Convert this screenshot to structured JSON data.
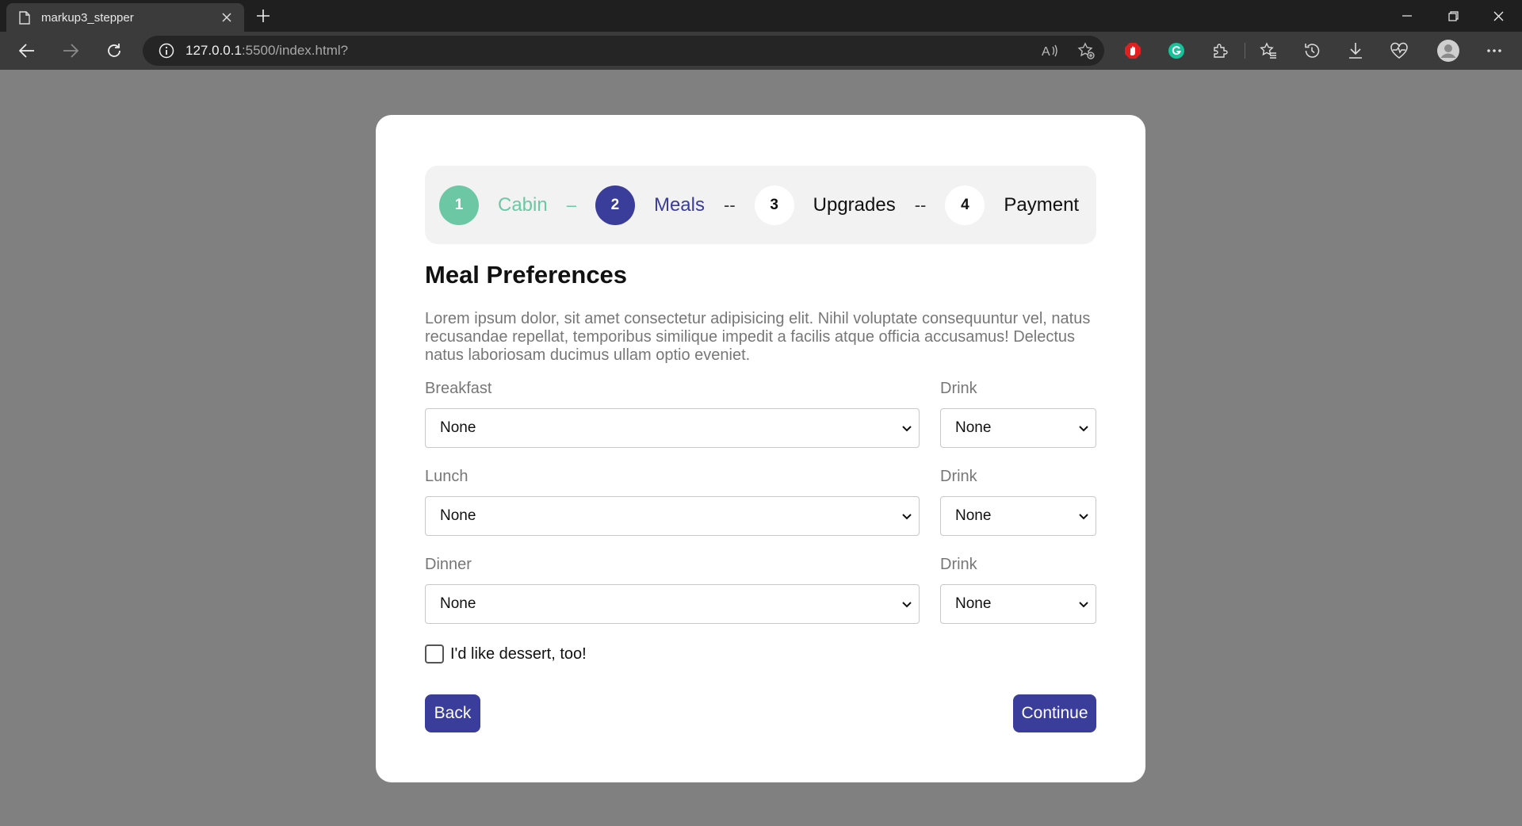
{
  "browser": {
    "tab_title": "markup3_stepper",
    "url_host": "127.0.0.1",
    "url_rest": ":5500/index.html?"
  },
  "stepper": {
    "steps": [
      {
        "number": "1",
        "label": "Cabin",
        "state": "done"
      },
      {
        "number": "2",
        "label": "Meals",
        "state": "active"
      },
      {
        "number": "3",
        "label": "Upgrades",
        "state": "todo"
      },
      {
        "number": "4",
        "label": "Payment",
        "state": "todo"
      }
    ],
    "dividers": [
      "–",
      "--",
      "--"
    ]
  },
  "form": {
    "heading": "Meal Preferences",
    "description": "Lorem ipsum dolor, sit amet consectetur adipisicing elit. Nihil voluptate consequuntur vel, natus recusandae repellat, temporibus similique impedit a facilis atque officia accusamus! Delectus natus laboriosam ducimus ullam optio eveniet.",
    "rows": [
      {
        "meal_label": "Breakfast",
        "meal_value": "None",
        "drink_label": "Drink",
        "drink_value": "None"
      },
      {
        "meal_label": "Lunch",
        "meal_value": "None",
        "drink_label": "Drink",
        "drink_value": "None"
      },
      {
        "meal_label": "Dinner",
        "meal_value": "None",
        "drink_label": "Drink",
        "drink_value": "None"
      }
    ],
    "dessert_label": "I'd like dessert, too!",
    "dessert_checked": false,
    "back_label": "Back",
    "continue_label": "Continue"
  },
  "colors": {
    "accent": "#3a3d9a",
    "done": "#6cc8a4",
    "backdrop": "#808080"
  }
}
